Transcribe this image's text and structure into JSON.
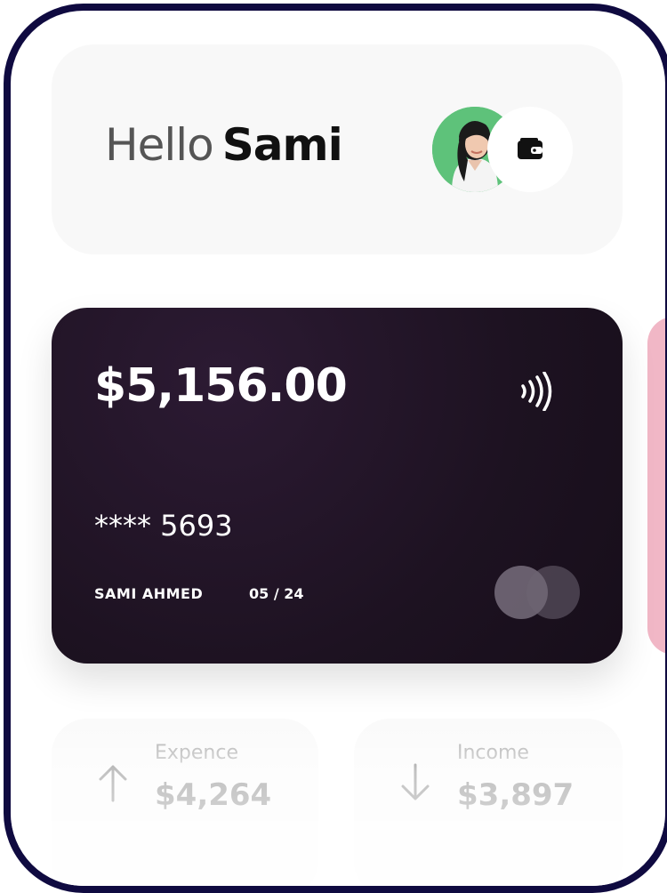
{
  "header": {
    "greeting": "Hello",
    "user_name": "Sami"
  },
  "card": {
    "balance": "$5,156.00",
    "number_masked": "**** 5693",
    "holder": "SAMI AHMED",
    "expiry": "05 / 24"
  },
  "stats": {
    "expense": {
      "label": "Expence",
      "value": "$4,264"
    },
    "income": {
      "label": "Income",
      "value": "$3,897"
    }
  },
  "icons": {
    "wallet": "wallet-icon",
    "contactless": "contactless-icon",
    "expense_arrow": "arrow-up-icon",
    "income_arrow": "arrow-down-icon"
  },
  "colors": {
    "frame": "#0f0a40",
    "avatar_bg": "#5ec27a",
    "card_bg": "#1d1221",
    "next_card": "#f1b7c6"
  }
}
